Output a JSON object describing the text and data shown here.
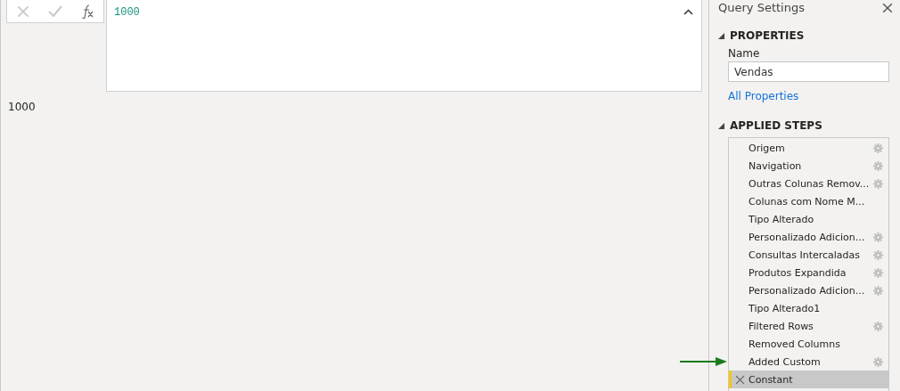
{
  "formula_bar": {
    "formula": "1000"
  },
  "result": "1000",
  "query_settings": {
    "title": "Query Settings",
    "properties": {
      "heading": "PROPERTIES",
      "name_label": "Name",
      "name_value": "Vendas",
      "link": "All Properties"
    },
    "applied_steps": {
      "heading": "APPLIED STEPS",
      "steps": [
        {
          "label": "Origem",
          "has_settings": true,
          "selected": false
        },
        {
          "label": "Navigation",
          "has_settings": true,
          "selected": false
        },
        {
          "label": "Outras Colunas Remov...",
          "has_settings": true,
          "selected": false
        },
        {
          "label": "Colunas com Nome M...",
          "has_settings": false,
          "selected": false
        },
        {
          "label": "Tipo Alterado",
          "has_settings": false,
          "selected": false
        },
        {
          "label": "Personalizado Adicion...",
          "has_settings": true,
          "selected": false
        },
        {
          "label": "Consultas Intercaladas",
          "has_settings": true,
          "selected": false
        },
        {
          "label": "Produtos Expandida",
          "has_settings": true,
          "selected": false
        },
        {
          "label": "Personalizado Adicion...",
          "has_settings": true,
          "selected": false
        },
        {
          "label": "Tipo Alterado1",
          "has_settings": false,
          "selected": false
        },
        {
          "label": "Filtered Rows",
          "has_settings": true,
          "selected": false
        },
        {
          "label": "Removed Columns",
          "has_settings": false,
          "selected": false
        },
        {
          "label": "Added Custom",
          "has_settings": true,
          "selected": false
        },
        {
          "label": "Constant",
          "has_settings": false,
          "selected": true
        }
      ]
    }
  }
}
